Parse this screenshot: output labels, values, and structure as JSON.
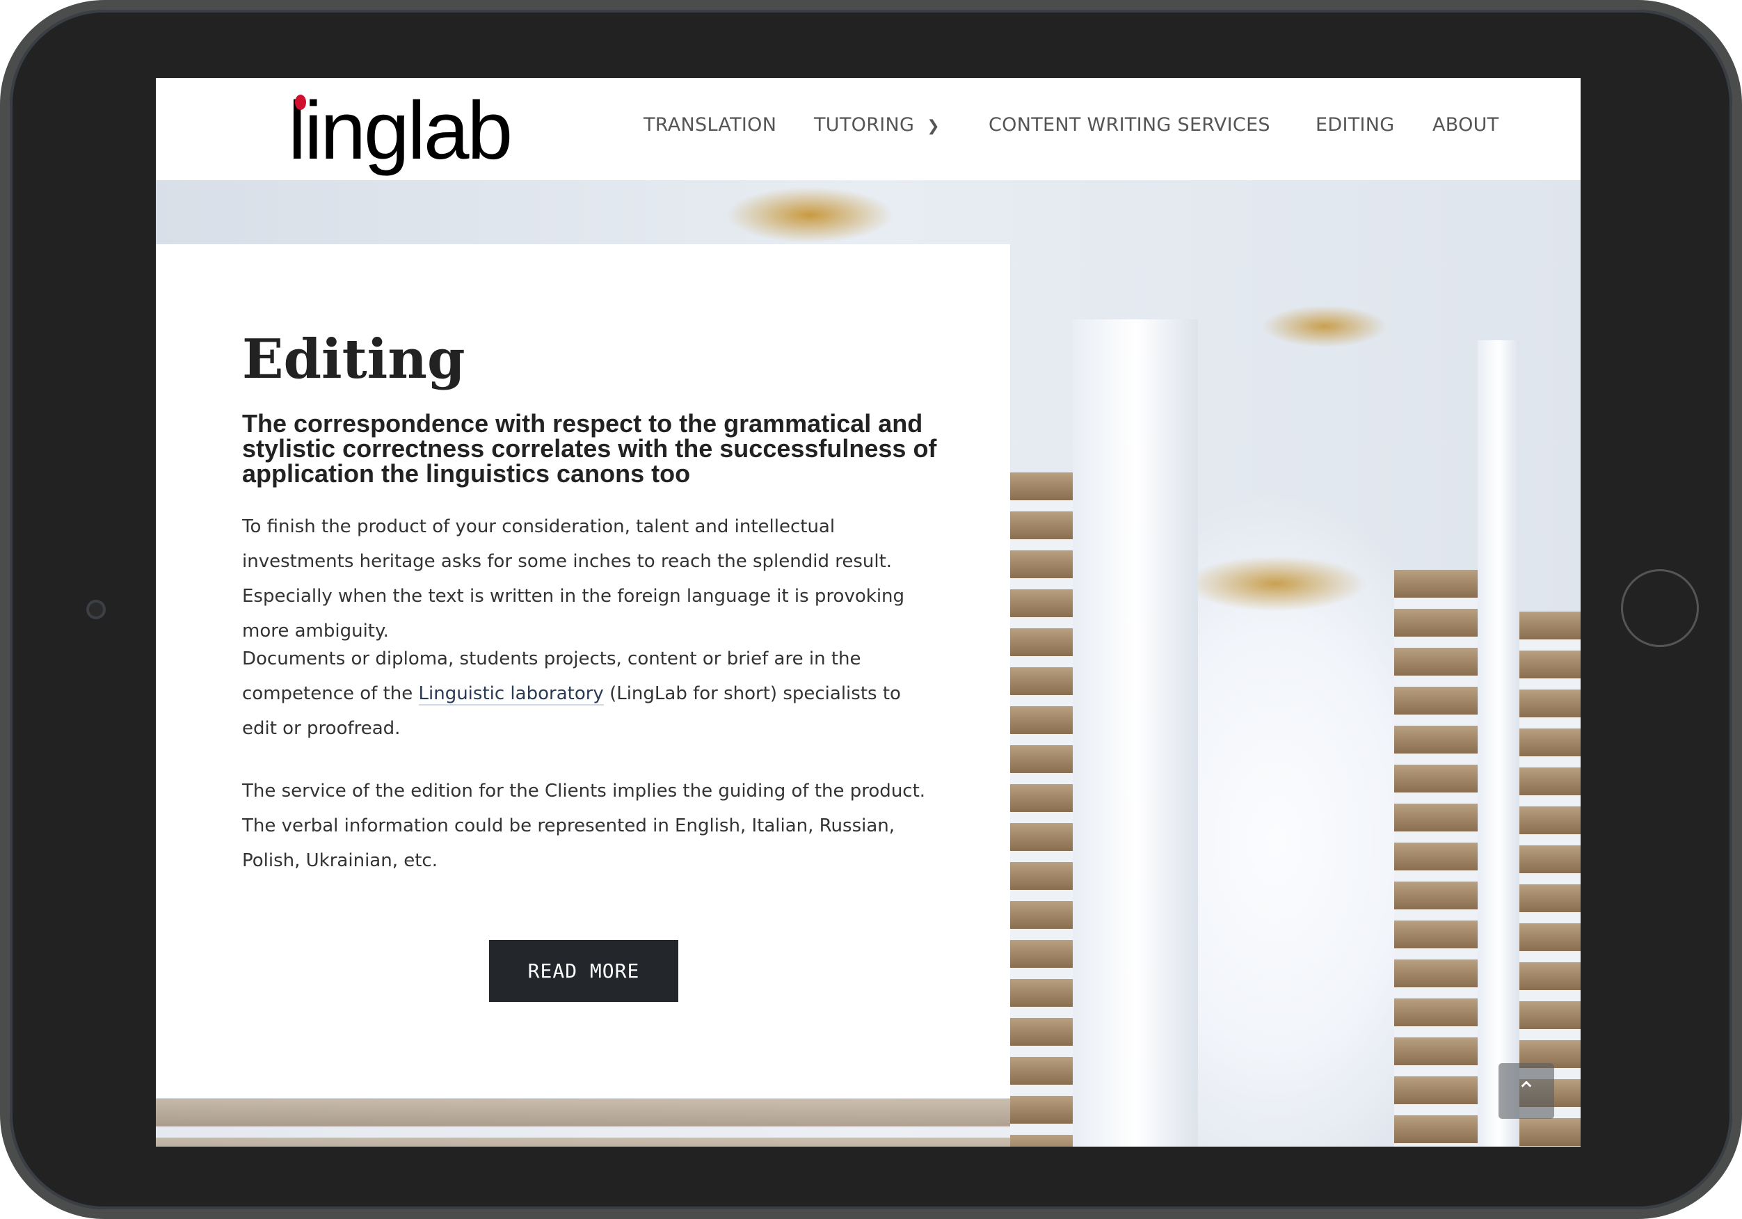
{
  "header": {
    "logo": "linglab",
    "nav": [
      {
        "label": "TRANSLATION"
      },
      {
        "label": "TUTORING",
        "has_dropdown": true
      },
      {
        "label": "CONTENT WRITING SERVICES"
      },
      {
        "label": "EDITING"
      },
      {
        "label": "ABOUT"
      }
    ]
  },
  "main": {
    "title": "Editing",
    "subtitle": "The correspondence with respect to the grammatical and stylistic correctness correlates with the successfulness of application the linguistics canons too",
    "p1": "To finish the product of your consideration, talent and intellectual investments heritage asks for some inches to reach the splendid result. Especially when the text is written in the foreign language it is provoking more ambiguity.",
    "p2_before": "Documents or diploma, students projects, content or brief are in the competence of the ",
    "p2_link": "Linguistic laboratory",
    "p2_after": " (LingLab for short) specialists to edit or proofread.",
    "p3": "The service of the edition for the Clients implies the guiding of the product. The verbal information could be represented in English, Italian, Russian, Polish, Ukrainian, etc.",
    "read_more": "READ MORE"
  },
  "icons": {
    "dropdown": "chevron-down-icon",
    "to_top": "chevron-up-icon"
  },
  "colors": {
    "logo_dot": "#d0102f",
    "button": "#23272c"
  }
}
